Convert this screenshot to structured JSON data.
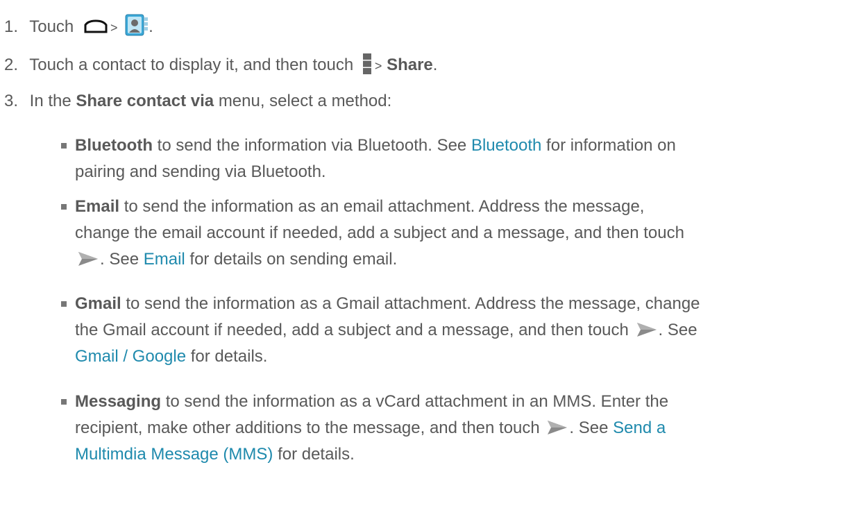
{
  "steps": [
    {
      "num": "1.",
      "text_before": "Touch",
      "sep": ">",
      "end": ".",
      "icons": [
        "home-icon",
        "contacts-app-icon"
      ]
    },
    {
      "num": "2.",
      "text_before": "Touch a contact to display it, and then touch",
      "sep": ">",
      "bold": "Share",
      "end": ".",
      "icons": [
        "menu-icon"
      ]
    },
    {
      "num": "3.",
      "text_before": "In the",
      "bold": "Share contact via",
      "text_after": "menu, select a method:"
    }
  ],
  "methods": [
    {
      "bold": "Bluetooth",
      "text1": "to send the information via Bluetooth. See",
      "link": "Bluetooth",
      "text2": "for information on",
      "text3": "pairing and sending via Bluetooth."
    },
    {
      "bold": "Email",
      "line1": "to send the information as an email attachment. Address the message,",
      "line2": "change the email account if needed, add a subject and a message, and then touch",
      "text_after_icon": ". See",
      "link": "Email",
      "text_end": "for details on sending email."
    },
    {
      "bold": "Gmail",
      "line1": "to send the information as a Gmail attachment. Address the message, change",
      "line2": "the Gmail account if needed, add a subject and a message, and then touch",
      "text_after_icon": ". See",
      "link": "Gmail / Google",
      "text_end": "for details."
    },
    {
      "bold": "Messaging",
      "line1": "to send the information as a vCard attachment in an MMS. Enter the",
      "line2": "recipient, make other additions to the message, and then touch",
      "text_after_icon": ". See",
      "link_part1": "Send a",
      "link_part2": "Multimdia Message (MMS)",
      "text_end": "for details."
    }
  ],
  "colors": {
    "text": "#595959",
    "link": "#1f8aad",
    "bullet": "#777777"
  }
}
